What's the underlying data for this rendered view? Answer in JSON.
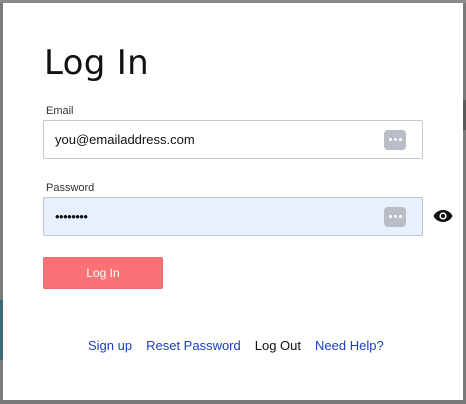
{
  "dialog": {
    "title": "Log In"
  },
  "email": {
    "label": "Email",
    "value": "you@emailaddress.com",
    "placeholder": ""
  },
  "password": {
    "label": "Password",
    "masked_value": "••••••••",
    "autofill_highlight_color": "#e8f0fe"
  },
  "login_button": {
    "label": "Log In",
    "color": "#fa7276"
  },
  "footer": {
    "links": [
      {
        "label": "Sign up",
        "color": "#1a3fbf"
      },
      {
        "label": "Reset Password",
        "color": "#1a3fbf"
      },
      {
        "label": "Log Out",
        "color": "#111111"
      },
      {
        "label": "Need Help?",
        "color": "#1a3fbf"
      }
    ]
  },
  "icons": {
    "keychain": "password-manager-key-icon",
    "show_password": "eye-icon"
  }
}
